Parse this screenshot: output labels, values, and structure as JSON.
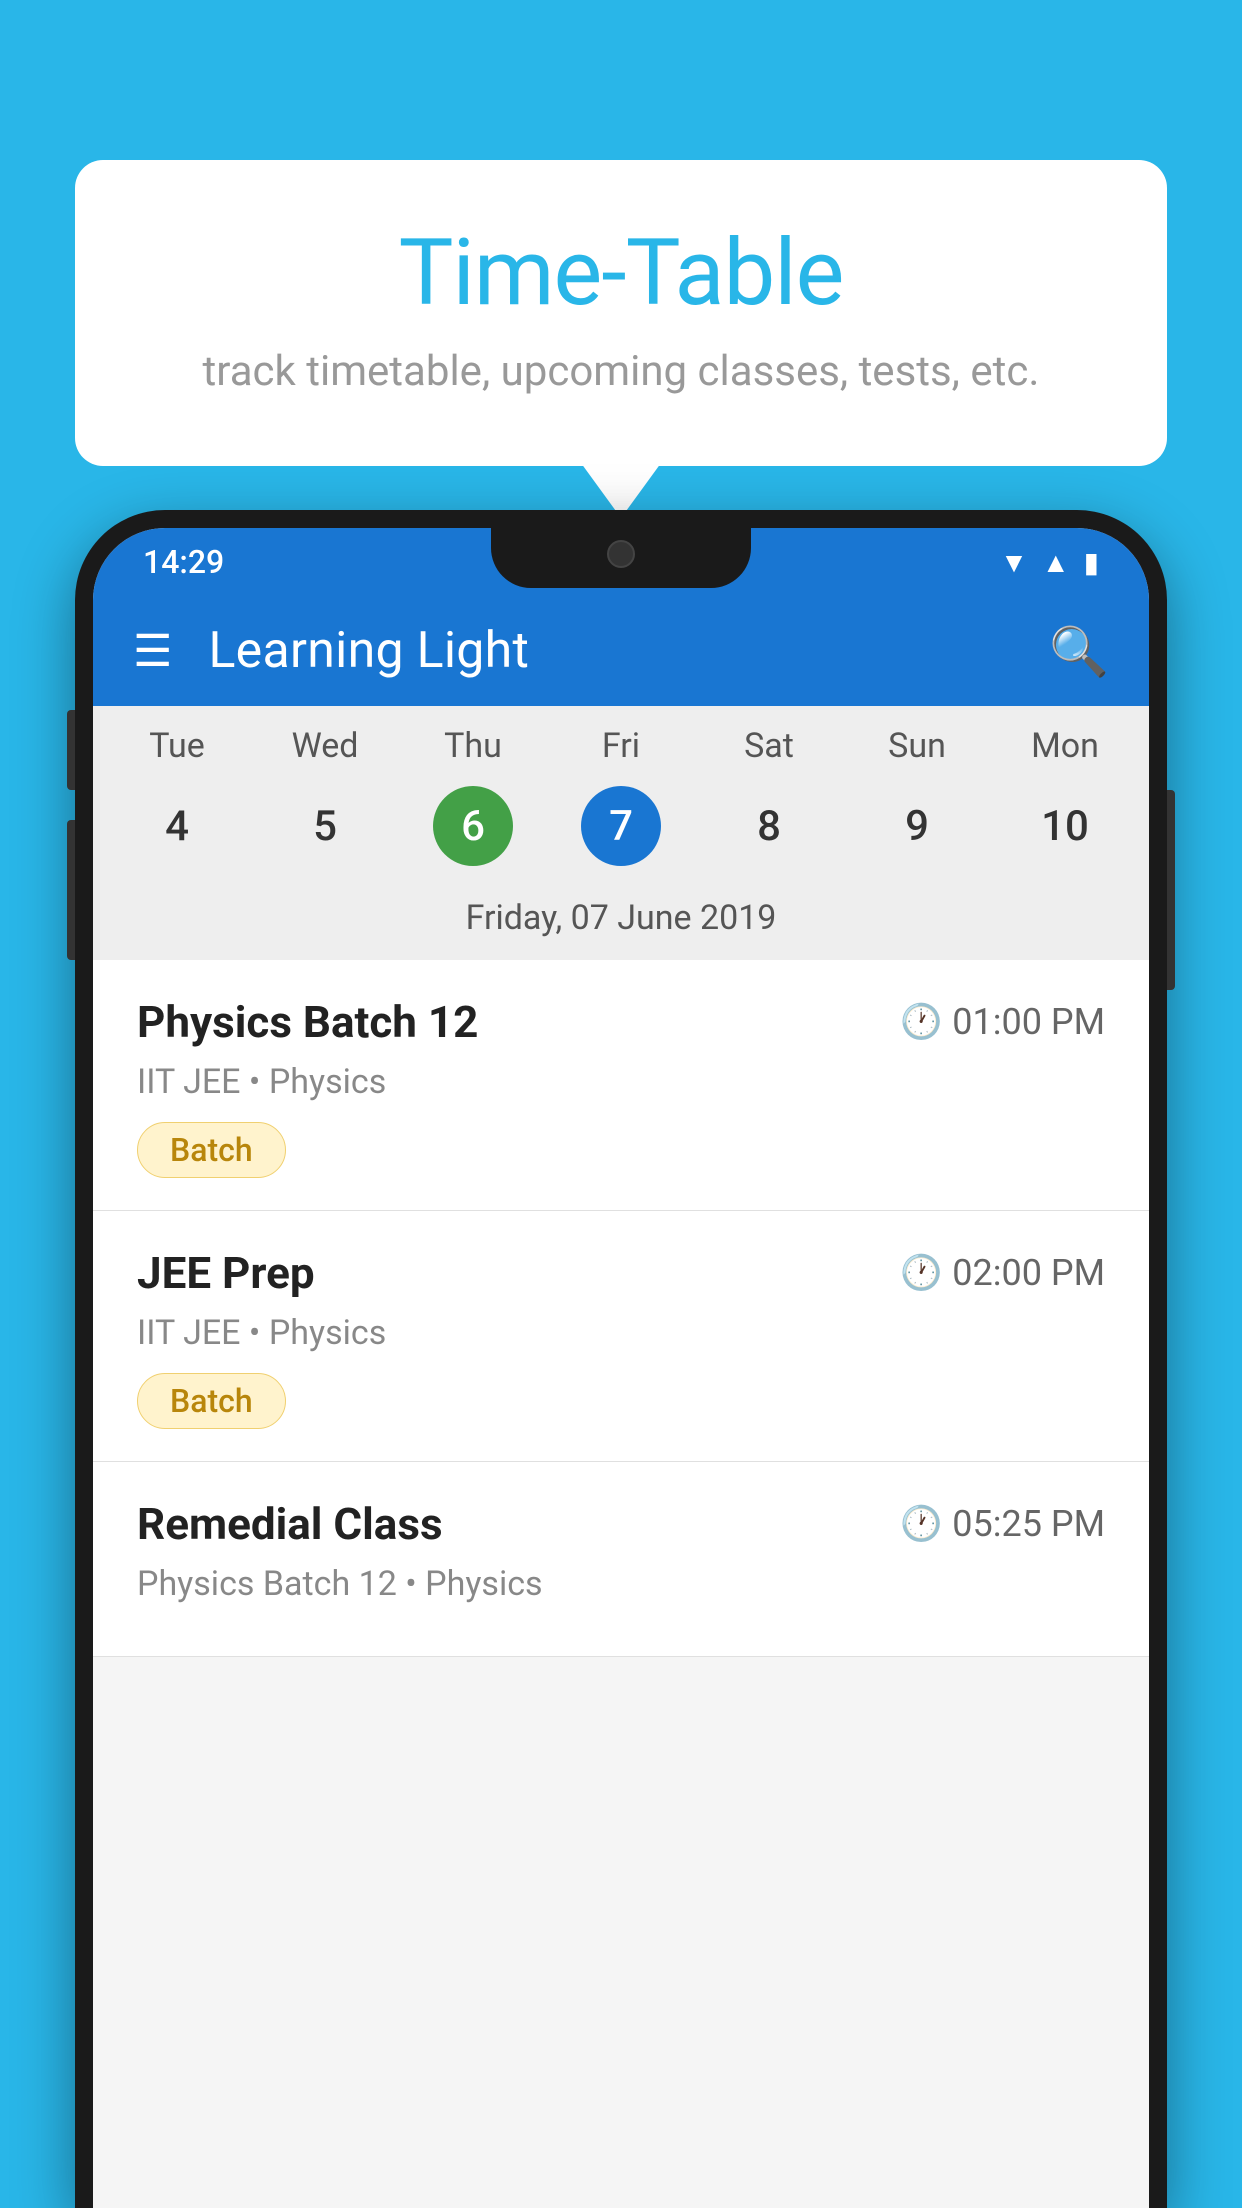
{
  "background_color": "#29b6e8",
  "tooltip": {
    "title": "Time-Table",
    "subtitle": "track timetable, upcoming classes, tests, etc."
  },
  "phone": {
    "status_bar": {
      "time": "14:29"
    },
    "app_bar": {
      "title": "Learning Light"
    },
    "calendar": {
      "weekdays": [
        "Tue",
        "Wed",
        "Thu",
        "Fri",
        "Sat",
        "Sun",
        "Mon"
      ],
      "dates": [
        {
          "num": "4",
          "state": "normal"
        },
        {
          "num": "5",
          "state": "normal"
        },
        {
          "num": "6",
          "state": "today"
        },
        {
          "num": "7",
          "state": "selected"
        },
        {
          "num": "8",
          "state": "normal"
        },
        {
          "num": "9",
          "state": "normal"
        },
        {
          "num": "10",
          "state": "normal"
        }
      ],
      "selected_date_label": "Friday, 07 June 2019"
    },
    "events": [
      {
        "title": "Physics Batch 12",
        "time": "01:00 PM",
        "meta": "IIT JEE • Physics",
        "badge": "Batch"
      },
      {
        "title": "JEE Prep",
        "time": "02:00 PM",
        "meta": "IIT JEE • Physics",
        "badge": "Batch"
      },
      {
        "title": "Remedial Class",
        "time": "05:25 PM",
        "meta": "Physics Batch 12 • Physics",
        "badge": null
      }
    ]
  }
}
